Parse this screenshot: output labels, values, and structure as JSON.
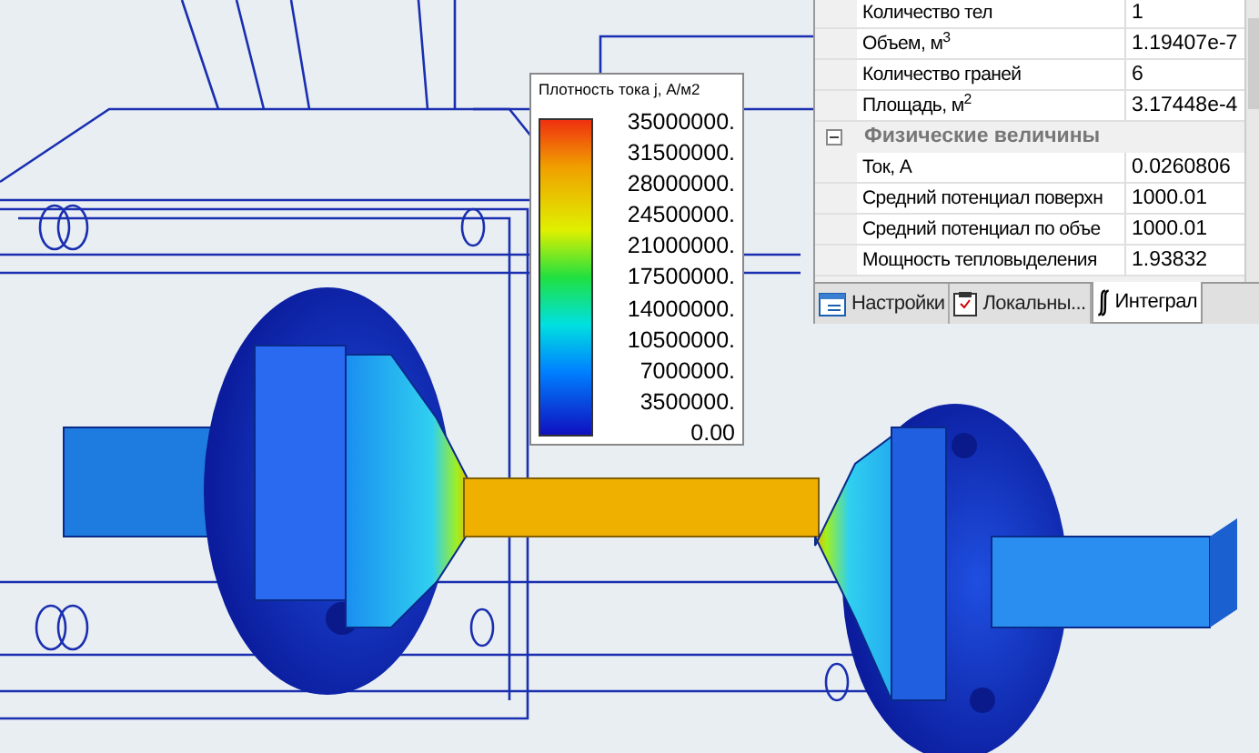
{
  "legend": {
    "title": "Плотность тока j, А/м2",
    "ticks": [
      "35000000.",
      "31500000.",
      "28000000.",
      "24500000.",
      "21000000.",
      "17500000.",
      "14000000.",
      "10500000.",
      "7000000.",
      "3500000.",
      "0.00"
    ]
  },
  "properties": {
    "rows": [
      {
        "kind": "row",
        "label": "Количество тел",
        "value": "1"
      },
      {
        "kind": "row",
        "label": "Объем, м$^{3}$",
        "value": "1.19407e-7"
      },
      {
        "kind": "row",
        "label": "Количество граней",
        "value": "6"
      },
      {
        "kind": "row",
        "label": "Площадь, м$^{2}$",
        "value": "3.17448e-4"
      },
      {
        "kind": "section",
        "label": "Физические величины",
        "expanded": true
      },
      {
        "kind": "row",
        "label": "Ток, А",
        "value": "0.0260806"
      },
      {
        "kind": "row",
        "label": "Средний потенциал поверхн",
        "value": "1000.01"
      },
      {
        "kind": "row",
        "label": "Средний потенциал по объе",
        "value": "1000.01"
      },
      {
        "kind": "row",
        "label": "Мощность тепловыделения",
        "value": "1.93832"
      }
    ],
    "tabs": [
      {
        "label": "Настройки",
        "selected": false
      },
      {
        "label": "Локальны...",
        "selected": false
      },
      {
        "label": "Интеграл",
        "selected": true
      }
    ]
  }
}
